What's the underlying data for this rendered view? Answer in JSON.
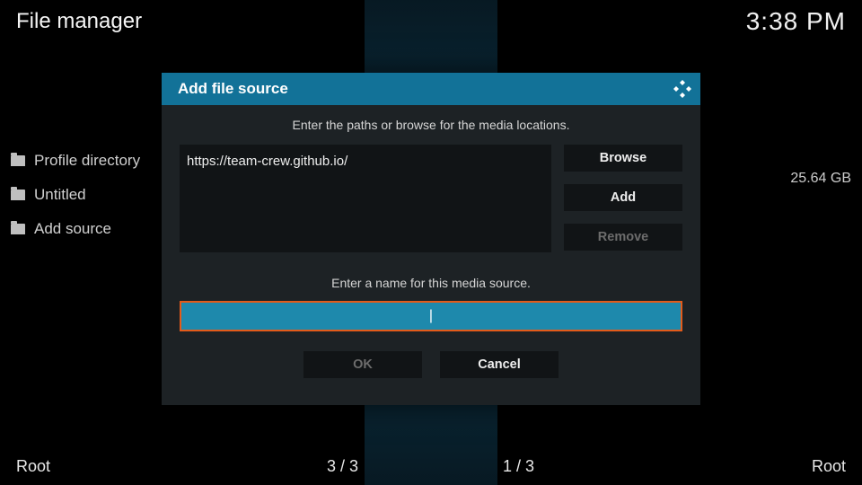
{
  "header": {
    "title": "File manager",
    "clock": "3:38 PM"
  },
  "files_left": [
    {
      "label": "Profile directory",
      "size": ""
    },
    {
      "label": "Untitled",
      "size": ""
    },
    {
      "label": "Add source",
      "size": ""
    }
  ],
  "files_right": [
    {
      "label": "",
      "size": "25.64 GB"
    }
  ],
  "status": {
    "left_root": "Root",
    "left_count": "3 / 3",
    "right_count": "1 / 3",
    "right_root": "Root"
  },
  "dialog": {
    "title": "Add file source",
    "prompt_paths": "Enter the paths or browse for the media locations.",
    "path_value": "https://team-crew.github.io/",
    "btn_browse": "Browse",
    "btn_add": "Add",
    "btn_remove": "Remove",
    "prompt_name": "Enter a name for this media source.",
    "name_value": "",
    "caret": "|",
    "btn_ok": "OK",
    "btn_cancel": "Cancel"
  }
}
